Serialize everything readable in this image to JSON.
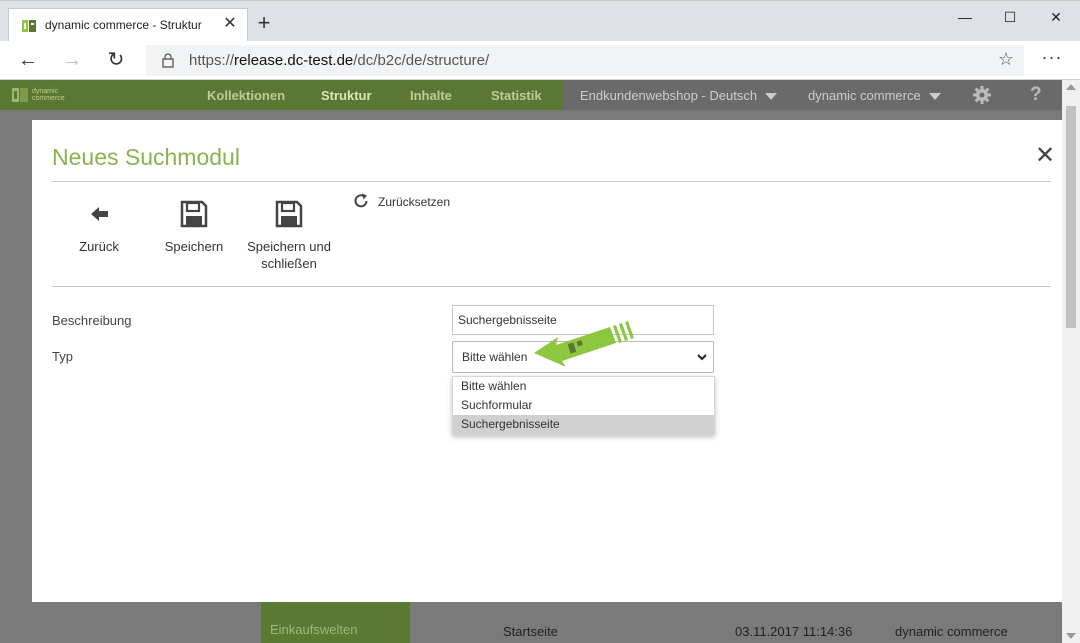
{
  "browser": {
    "tab_title": "dynamic commerce - Struktur",
    "url_prefix": "https://",
    "url_domain": "release.dc-test.de",
    "url_path": "/dc/b2c/de/structure/"
  },
  "appnav": {
    "logo_line1": "dynamic",
    "logo_line2": "commerce",
    "items": [
      "Kollektionen",
      "Struktur",
      "Inhalte",
      "Statistik"
    ],
    "active_item": "Struktur",
    "shop_select": "Endkundenwebshop - Deutsch",
    "company_select": "dynamic commerce"
  },
  "background": {
    "sidebar_item": "Einkaufswelten",
    "row": {
      "name": "Startseite",
      "date": "03.11.2017 11:14:36",
      "user": "dynamic commerce"
    }
  },
  "modal": {
    "title": "Neues Suchmodul",
    "toolbar": {
      "back_label": "Zurück",
      "save_label": "Speichern",
      "save_close_line1": "Speichern und",
      "save_close_line2": "schließen",
      "reset_label": "Zurücksetzen"
    },
    "form": {
      "description_label": "Beschreibung",
      "description_value": "Suchergebnisseite",
      "type_label": "Typ",
      "type_selected": "Bitte wählen",
      "type_options": [
        "Bitte wählen",
        "Suchformular",
        "Suchergebnisseite"
      ],
      "highlighted_option": "Suchergebnisseite"
    }
  },
  "colors": {
    "brand_green": "#8ab34f",
    "nav_green": "#5a7833",
    "arrow_green": "#8dc63f"
  }
}
